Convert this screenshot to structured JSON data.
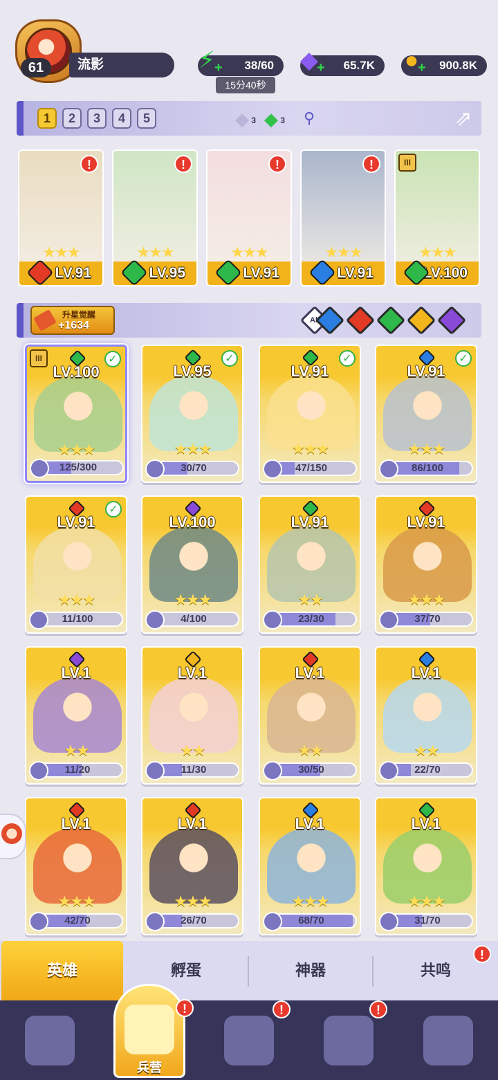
{
  "player": {
    "level": "61",
    "name": "流影"
  },
  "resources": {
    "energy": {
      "icon": "lightning-icon",
      "value": "38/60",
      "timer": "15分40秒"
    },
    "gems": {
      "icon": "purple-gem-icon",
      "value": "65.7K"
    },
    "gold": {
      "icon": "gold-coin-icon",
      "value": "900.8K"
    }
  },
  "team_tabs": [
    "1",
    "2",
    "3",
    "4",
    "5"
  ],
  "active_team_tab": 0,
  "team_tokens": [
    {
      "icon": "white-crystal-icon",
      "count": "3"
    },
    {
      "icon": "green-crystal-icon",
      "count": "3"
    }
  ],
  "colors": {
    "fire": "#e23a24",
    "nature": "#2fb84a",
    "water": "#2a7ee2",
    "light": "#f2b51b",
    "dark": "#8a4ad8",
    "accent": "#5d56c8"
  },
  "team": [
    {
      "level": "LV.91",
      "element": "fire",
      "stars": "★★★",
      "alert": "!",
      "art": "#e9dcc0"
    },
    {
      "level": "LV.95",
      "element": "nature",
      "stars": "★★★",
      "alert": "!",
      "art": "#cfe6c4"
    },
    {
      "level": "LV.91",
      "element": "nature",
      "stars": "★★★",
      "alert": "!",
      "art": "#f3dde0"
    },
    {
      "level": "LV.91",
      "element": "water",
      "stars": "★★★",
      "alert": "!",
      "art": "#aab6cc"
    },
    {
      "level": "LV.100",
      "element": "nature",
      "stars": "★★★",
      "alert": "",
      "art": "#c9e3b4"
    }
  ],
  "upgrade": {
    "title": "升星觉醒",
    "value": "+1634"
  },
  "filters": {
    "all_label": "All",
    "elements": [
      "water",
      "fire",
      "nature",
      "light",
      "dark"
    ]
  },
  "heroes": [
    {
      "level": "LV.100",
      "element": "nature",
      "stars": "★★★",
      "progress": "125/300",
      "ratio": 0.42,
      "check": true,
      "rank": true,
      "selected": true,
      "art": "#a9cf8e"
    },
    {
      "level": "LV.95",
      "element": "nature",
      "stars": "★★★",
      "progress": "30/70",
      "ratio": 0.43,
      "check": true,
      "art": "#bfe4d6"
    },
    {
      "level": "LV.91",
      "element": "nature",
      "stars": "★★★",
      "progress": "47/150",
      "ratio": 0.31,
      "check": true,
      "art": "#fbe08f"
    },
    {
      "level": "LV.91",
      "element": "water",
      "stars": "★★★",
      "progress": "86/100",
      "ratio": 0.86,
      "check": true,
      "art": "#b9c2cf"
    },
    {
      "level": "LV.91",
      "element": "fire",
      "stars": "★★★",
      "progress": "11/100",
      "ratio": 0.11,
      "check": true,
      "art": "#f2dfa6"
    },
    {
      "level": "LV.100",
      "element": "dark",
      "stars": "★★★",
      "progress": "4/100",
      "ratio": 0.04,
      "check": false,
      "art": "#6f8a86"
    },
    {
      "level": "LV.91",
      "element": "nature",
      "stars": "★★",
      "progress": "23/30",
      "ratio": 0.77,
      "check": false,
      "art": "#b6c6ae"
    },
    {
      "level": "LV.91",
      "element": "fire",
      "stars": "★★★",
      "progress": "37/70",
      "ratio": 0.53,
      "check": false,
      "art": "#d99a4a"
    },
    {
      "level": "LV.1",
      "element": "dark",
      "stars": "★★",
      "progress": "11/20",
      "ratio": 0.55,
      "check": false,
      "art": "#a788d2"
    },
    {
      "level": "LV.1",
      "element": "light",
      "stars": "★★",
      "progress": "11/30",
      "ratio": 0.37,
      "check": false,
      "art": "#f3d0d4"
    },
    {
      "level": "LV.1",
      "element": "fire",
      "stars": "★★",
      "progress": "30/50",
      "ratio": 0.6,
      "check": false,
      "art": "#d9b693"
    },
    {
      "level": "LV.1",
      "element": "water",
      "stars": "★★",
      "progress": "22/70",
      "ratio": 0.31,
      "check": false,
      "art": "#b7d8ef"
    },
    {
      "level": "LV.1",
      "element": "fire",
      "stars": "★★★",
      "progress": "42/70",
      "ratio": 0.6,
      "check": false,
      "art": "#e86a3b"
    },
    {
      "level": "LV.1",
      "element": "fire",
      "stars": "★★★",
      "progress": "26/70",
      "ratio": 0.37,
      "check": false,
      "art": "#5b5060"
    },
    {
      "level": "LV.1",
      "element": "water",
      "stars": "★★★",
      "progress": "68/70",
      "ratio": 0.97,
      "check": false,
      "art": "#8fb5da"
    },
    {
      "level": "LV.1",
      "element": "nature",
      "stars": "★★★",
      "progress": "31/70",
      "ratio": 0.44,
      "check": false,
      "art": "#9bcf6a"
    }
  ],
  "subtabs": [
    {
      "label": "英雄",
      "active": true,
      "alert": false
    },
    {
      "label": "孵蛋",
      "active": false,
      "alert": false
    },
    {
      "label": "神器",
      "active": false,
      "alert": false
    },
    {
      "label": "共鸣",
      "active": false,
      "alert": true
    }
  ],
  "nav": [
    {
      "icon": "cards-icon",
      "label": "",
      "alert": false,
      "active": false
    },
    {
      "icon": "barracks-icon",
      "label": "兵营",
      "alert": true,
      "active": true
    },
    {
      "icon": "map-icon",
      "label": "",
      "alert": true,
      "active": false
    },
    {
      "icon": "castle-icon",
      "label": "",
      "alert": true,
      "active": false
    },
    {
      "icon": "mushroom-icon",
      "label": "",
      "alert": false,
      "active": false
    }
  ],
  "alert_mark": "!"
}
